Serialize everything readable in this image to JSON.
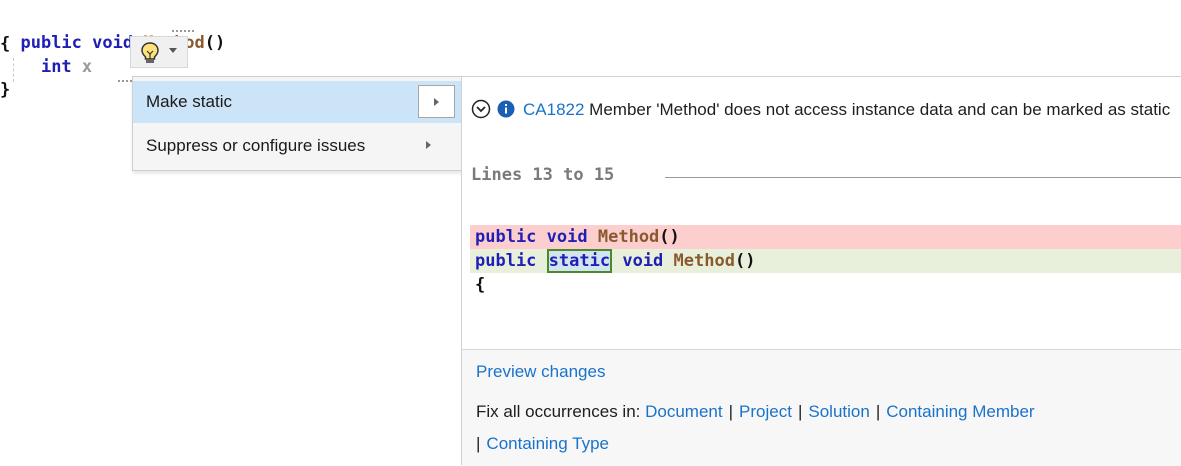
{
  "editor": {
    "line1": {
      "kw1": "public",
      "kw2": "void",
      "name": "Method",
      "punc": "()"
    },
    "line2": "{",
    "line3": {
      "kw": "int",
      "rest": "x"
    },
    "line4": "}"
  },
  "lightbulb": {
    "icon": "lightbulb-icon"
  },
  "quick_actions": {
    "items": [
      {
        "label": "Make static"
      },
      {
        "label": "Suppress or configure issues"
      }
    ]
  },
  "preview": {
    "diagnostic": {
      "code": "CA1822",
      "message": "Member 'Method' does not access instance data and can be marked as static"
    },
    "lines_header": "Lines 13 to 15",
    "removed": {
      "kw1": "public",
      "kw2": "void",
      "name": "Method",
      "punc": "()"
    },
    "added": {
      "kw1": "public",
      "kw_static": "static",
      "kw2": "void",
      "name": "Method",
      "punc": "()"
    },
    "brace": "{",
    "preview_changes": "Preview changes",
    "fix_all": {
      "prefix": "Fix all occurrences in:",
      "document": "Document",
      "project": "Project",
      "solution": "Solution",
      "containing_member": "Containing Member",
      "containing_type": "Containing Type",
      "separator": "|"
    }
  },
  "colors": {
    "keyword": "#1f1fb6",
    "method": "#8a5a2e",
    "link": "#1a73c9",
    "removed_bg": "#fccfce",
    "added_bg": "#e8f0dc",
    "selected_item_bg": "#cce4f7"
  }
}
